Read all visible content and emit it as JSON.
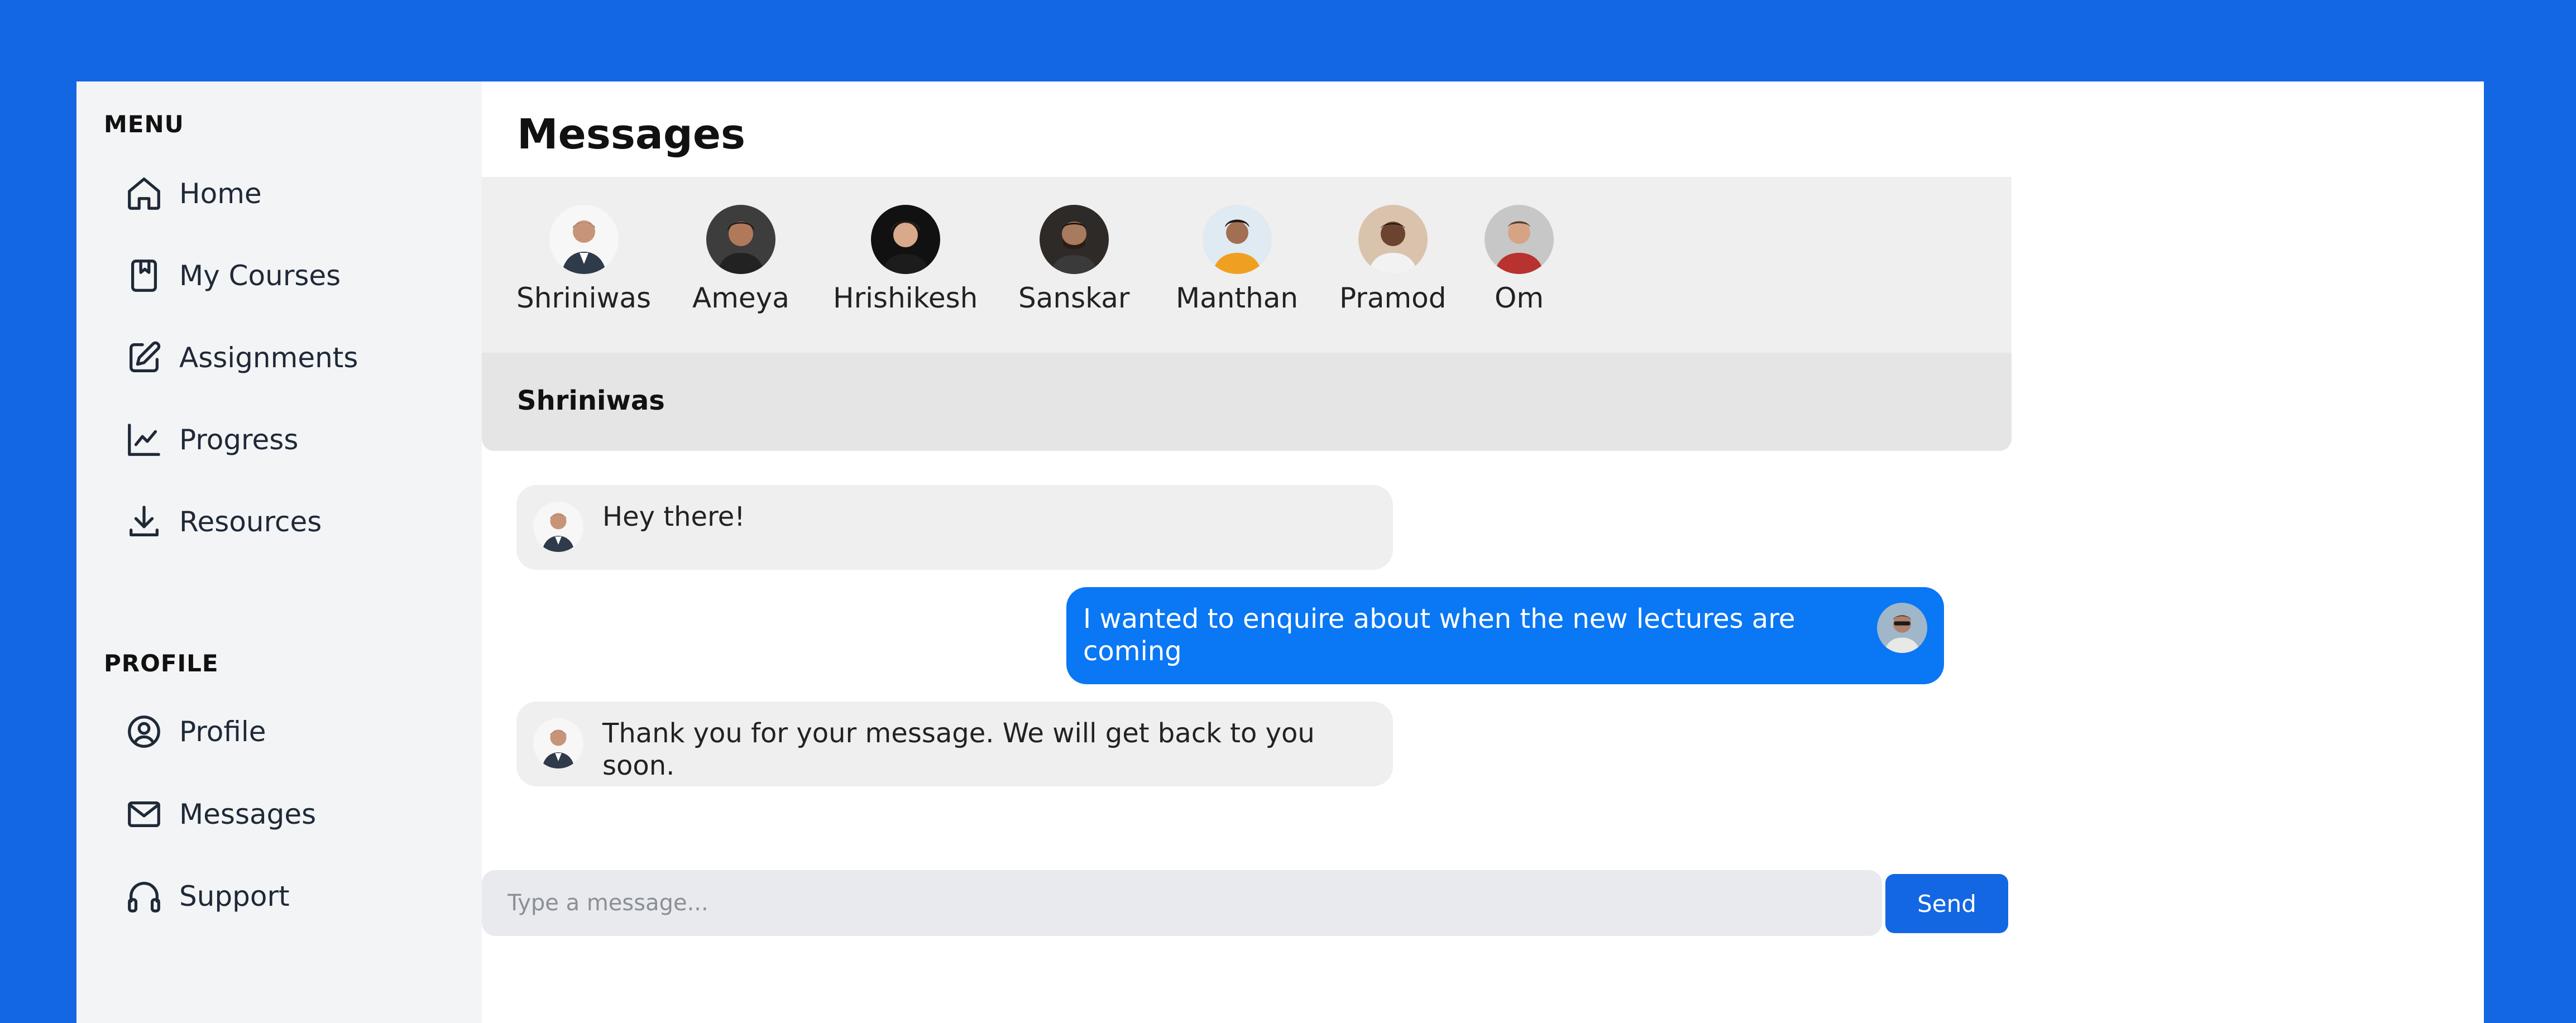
{
  "sidebar": {
    "menu_label": "MENU",
    "profile_label": "PROFILE",
    "menu_items": [
      {
        "label": "Home",
        "icon": "home-icon"
      },
      {
        "label": "My Courses",
        "icon": "bookmark-book-icon"
      },
      {
        "label": "Assignments",
        "icon": "edit-square-icon"
      },
      {
        "label": "Progress",
        "icon": "line-chart-icon"
      },
      {
        "label": "Resources",
        "icon": "download-icon"
      }
    ],
    "profile_items": [
      {
        "label": "Profile",
        "icon": "user-circle-icon"
      },
      {
        "label": "Messages",
        "icon": "mail-icon"
      },
      {
        "label": "Support",
        "icon": "headphones-icon"
      }
    ]
  },
  "page": {
    "title": "Messages"
  },
  "contacts": [
    {
      "name": "Shriniwas"
    },
    {
      "name": "Ameya"
    },
    {
      "name": "Hrishikesh"
    },
    {
      "name": "Sanskar"
    },
    {
      "name": "Manthan"
    },
    {
      "name": "Pramod"
    },
    {
      "name": "Om"
    }
  ],
  "chat": {
    "active_contact": "Shriniwas",
    "messages": [
      {
        "direction": "incoming",
        "text": "Hey there!"
      },
      {
        "direction": "outgoing",
        "text": "I wanted to enquire about when the new lectures are coming"
      },
      {
        "direction": "incoming",
        "text": "Thank you for your message. We will get back to you soon."
      }
    ]
  },
  "composer": {
    "placeholder": "Type a message...",
    "value": "",
    "send_label": "Send"
  },
  "colors": {
    "accent": "#1467e3",
    "outgoing_bubble": "#0a77f4",
    "incoming_bubble": "#efefef",
    "sidebar_bg": "#f3f4f6"
  }
}
